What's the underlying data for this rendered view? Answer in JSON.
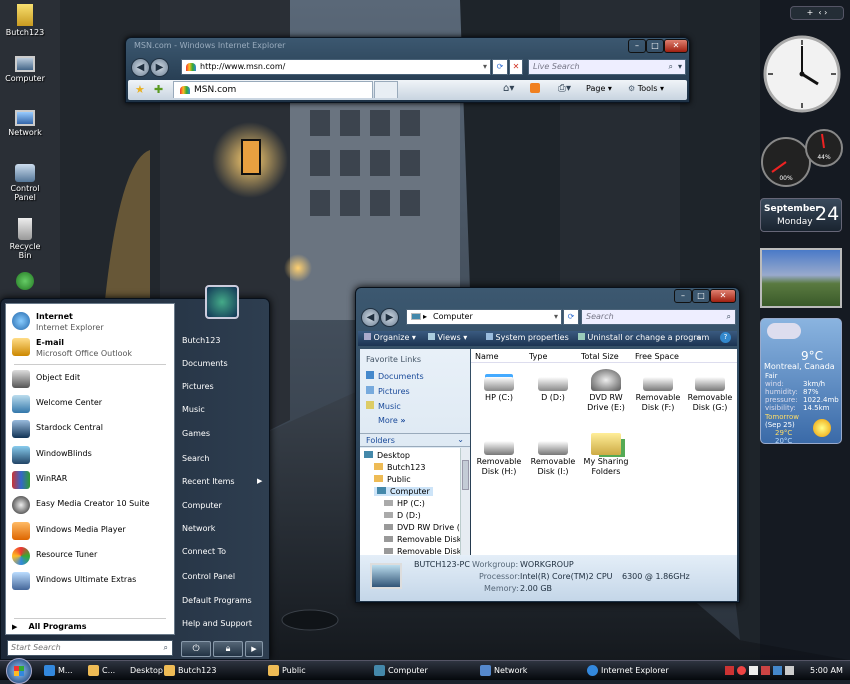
{
  "desktop": {
    "icons": [
      {
        "label": "Butch123"
      },
      {
        "label": "Computer"
      },
      {
        "label": "Network"
      },
      {
        "label": "Control Panel"
      },
      {
        "label": "Recycle Bin"
      }
    ]
  },
  "ie": {
    "title": "MSN.com - Windows Internet Explorer",
    "url": "http://www.msn.com/",
    "search_placeholder": "Live Search",
    "tab_label": "MSN.com",
    "page_label": "Page",
    "tools_label": "Tools"
  },
  "start_menu": {
    "pinned": [
      {
        "title": "Internet",
        "subtitle": "Internet Explorer"
      },
      {
        "title": "E-mail",
        "subtitle": "Microsoft Office Outlook"
      }
    ],
    "recent": [
      "Object Edit",
      "Welcome Center",
      "Stardock Central",
      "WindowBlinds",
      "WinRAR",
      "Easy Media Creator 10 Suite",
      "Windows Media Player",
      "Resource Tuner",
      "Windows Ultimate Extras"
    ],
    "all_programs": "All Programs",
    "search_placeholder": "Start Search",
    "right": [
      "Butch123",
      "Documents",
      "Pictures",
      "Music",
      "Games",
      "Search",
      "Recent Items",
      "Computer",
      "Network",
      "Connect To",
      "Control Panel",
      "Default Programs",
      "Help and Support"
    ]
  },
  "explorer": {
    "address": "Computer",
    "search_placeholder": "Search",
    "commands": [
      "Organize",
      "Views",
      "System properties",
      "Uninstall or change a program"
    ],
    "favorites_title": "Favorite Links",
    "favorites": [
      "Documents",
      "Pictures",
      "Music",
      "More"
    ],
    "folders_title": "Folders",
    "tree": [
      "Desktop",
      "Butch123",
      "Public",
      "Computer",
      "HP (C:)",
      "D (D:)",
      "DVD RW Drive (E",
      "Removable Disk",
      "Removable Disk"
    ],
    "columns": [
      "Name",
      "Type",
      "Total Size",
      "Free Space"
    ],
    "items": [
      "HP (C:)",
      "D (D:)",
      "DVD RW Drive (E:)",
      "Removable Disk (F:)",
      "Removable Disk (G:)",
      "Removable Disk (H:)",
      "Removable Disk (I:)",
      "My Sharing Folders"
    ],
    "details": {
      "name": "BUTCH123-PC",
      "workgroup_label": "Workgroup:",
      "workgroup": "WORKGROUP",
      "processor_label": "Processor:",
      "processor": "Intel(R) Core(TM)2 CPU",
      "processor_speed": "6300 @ 1.86GHz",
      "memory_label": "Memory:",
      "memory": "2.00 GB"
    }
  },
  "gadgets": {
    "calendar": {
      "month": "September",
      "weekday": "Monday",
      "day": "24"
    },
    "meter": {
      "cpu": "00%",
      "mem": "44%"
    },
    "weather": {
      "temp": "9°C",
      "city": "Montreal, Canada",
      "condition": "Fair",
      "wind_label": "wind:",
      "wind": "3km/h",
      "humidity_label": "humidity:",
      "humidity": "87%",
      "pressure_label": "pressure:",
      "pressure": "1022.4mb",
      "visibility_label": "visibility:",
      "visibility": "14.5km",
      "tomorrow": "Tomorrow",
      "tomorrow_date": "(Sep 25)",
      "high": "29°C",
      "low": "20°C"
    }
  },
  "taskbar": {
    "items": [
      "M...",
      "C...",
      "Desktop",
      "Butch123",
      "Public",
      "Computer",
      "Network",
      "Internet Explorer"
    ],
    "clock": "5:00 AM"
  }
}
